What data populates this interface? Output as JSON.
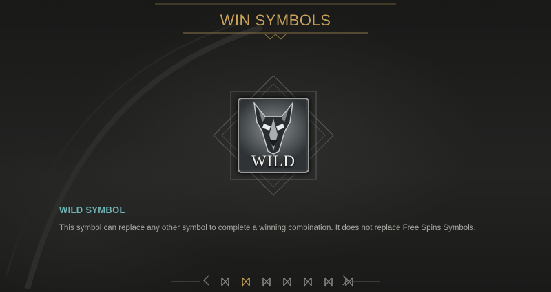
{
  "title": "WIN SYMBOLS",
  "symbol": {
    "badge_text": "WILD",
    "icon": "wolf-head-icon"
  },
  "section": {
    "heading": "WILD SYMBOL",
    "description": "This symbol can replace any other symbol to complete a winning combination. It does not replace Free Spins Symbols."
  },
  "pager": {
    "total_pages": 7,
    "current_page": 2
  },
  "colors": {
    "gold": "#c8a25a",
    "teal": "#6fb3b5",
    "text": "#a7a7a2"
  }
}
